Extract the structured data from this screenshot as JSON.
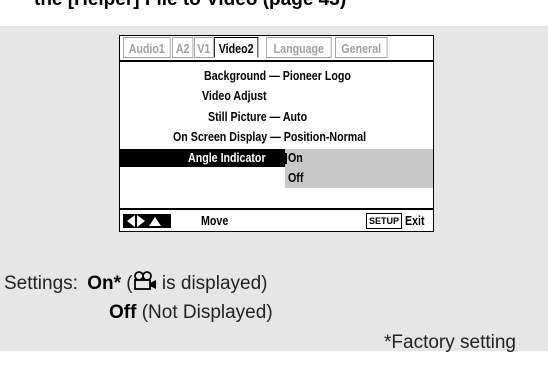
{
  "header": {
    "cut_text": "the [Helper] File to Video (page 43)"
  },
  "osd": {
    "tabs": [
      "Audio1",
      "A2",
      "V1",
      "Video2",
      "Language",
      "General"
    ],
    "active_tab": "Video2",
    "menu": {
      "background": "Background — Pioneer Logo",
      "video_adjust": "Video Adjust",
      "still_picture": "Still Picture — Auto",
      "on_screen_display": "On Screen Display — Position-Normal",
      "angle_indicator": "Angle Indicator"
    },
    "dropdown_options": [
      "On",
      "Off"
    ],
    "dropdown_selected": "On",
    "footer": {
      "move_label": "Move",
      "setup_key": "SETUP",
      "exit_label": "Exit"
    },
    "icons": {
      "arrows": "cursor-arrows-icon",
      "setup": "setup-key-icon"
    },
    "colors": {
      "panel": "#e6e6e6",
      "highlight": "#000000",
      "dropdown": "#c8c8c8"
    }
  },
  "settings": {
    "label": "Settings:",
    "on_bold": "On*",
    "on_open": " (",
    "on_desc": " is displayed)",
    "off_bold": "Off",
    "off_desc": " (Not Displayed)",
    "footnote": "*Factory setting",
    "icon": "angle-camera-icon"
  }
}
